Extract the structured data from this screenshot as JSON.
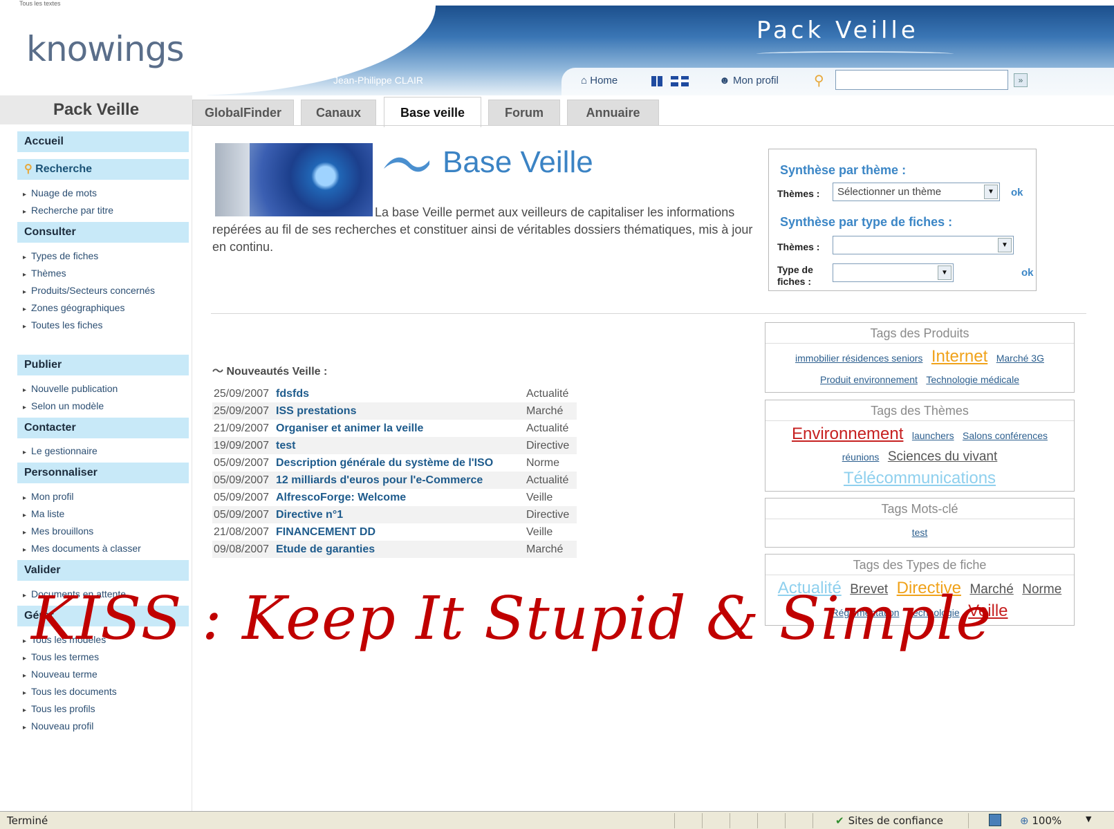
{
  "header": {
    "top_crumb": "Tous les textes",
    "logo_text": "knowings",
    "brand_title": "Pack Veille",
    "user_name": "Jean-Philippe CLAIR",
    "home_label": "Home",
    "profile_label": "Mon profil",
    "search_value": ""
  },
  "left": {
    "title": "Pack Veille",
    "accueil": "Accueil",
    "recherche": "Recherche",
    "recherche_items": [
      "Nuage de mots",
      "Recherche par titre"
    ],
    "consulter": "Consulter",
    "consulter_items": [
      "Types de fiches",
      "Thèmes",
      "Produits/Secteurs concernés",
      "Zones géographiques",
      "Toutes les fiches"
    ],
    "publier": "Publier",
    "publier_items": [
      "Nouvelle publication",
      "Selon un modèle"
    ],
    "contacter": "Contacter",
    "contacter_items": [
      "Le gestionnaire"
    ],
    "personnaliser": "Personnaliser",
    "personnaliser_items": [
      "Mon profil",
      "Ma liste",
      "Mes brouillons",
      "Mes documents à classer"
    ],
    "valider": "Valider",
    "valider_items": [
      "Documents en attente"
    ],
    "gerer": "Gérer",
    "gerer_items": [
      "Tous les modèles",
      "Tous les termes",
      "Nouveau terme",
      "Tous les documents",
      "Tous les profils",
      "Nouveau profil"
    ]
  },
  "tabs": [
    "GlobalFinder",
    "Canaux",
    "Base veille",
    "Forum",
    "Annuaire"
  ],
  "intro": {
    "title": "Base Veille",
    "text": "La base Veille permet aux veilleurs de capitaliser les informations repérées au fil de ses recherches et constituer ainsi de véritables dossiers thématiques, mis à jour en continu."
  },
  "synthese": {
    "theme_head": "Synthèse par thème :",
    "themes_label": "Thèmes :",
    "theme_select": "Sélectionner un thème",
    "ok": "ok",
    "type_head": "Synthèse par type de fiches :",
    "themes_label2": "Thèmes :",
    "type_label": "Type de fiches :"
  },
  "news": {
    "heading": "Nouveautés Veille :",
    "rows": [
      {
        "date": "25/09/2007",
        "title": "fdsfds",
        "type": "Actualité"
      },
      {
        "date": "25/09/2007",
        "title": "ISS prestations",
        "type": "Marché"
      },
      {
        "date": "21/09/2007",
        "title": "Organiser et animer la veille",
        "type": "Actualité"
      },
      {
        "date": "19/09/2007",
        "title": "test",
        "type": "Directive"
      },
      {
        "date": "05/09/2007",
        "title": "Description générale du système de l'ISO",
        "type": "Norme"
      },
      {
        "date": "05/09/2007",
        "title": "12 milliards d'euros pour l'e-Commerce",
        "type": "Actualité"
      },
      {
        "date": "05/09/2007",
        "title": "AlfrescoForge: Welcome",
        "type": "Veille"
      },
      {
        "date": "05/09/2007",
        "title": "Directive n°1",
        "type": "Directive"
      },
      {
        "date": "21/08/2007",
        "title": "FINANCEMENT DD",
        "type": "Veille"
      },
      {
        "date": "09/08/2007",
        "title": "Etude de garanties",
        "type": "Marché"
      }
    ]
  },
  "tags": {
    "produits_head": "Tags des Produits",
    "produits": [
      {
        "label": "immobilier résidences seniors",
        "size": "small",
        "color": "#2b5e8e"
      },
      {
        "label": "Internet",
        "size": "large",
        "color": "#f0a21a"
      },
      {
        "label": "Marché 3G",
        "size": "small",
        "color": "#2b5e8e"
      },
      {
        "label": "Produit environnement",
        "size": "small",
        "color": "#2b5e8e"
      },
      {
        "label": "Technologie médicale",
        "size": "small",
        "color": "#2b5e8e"
      }
    ],
    "themes_head": "Tags des Thèmes",
    "themes": [
      {
        "label": "Environnement",
        "size": "large",
        "color": "#c62020"
      },
      {
        "label": "launchers",
        "size": "small",
        "color": "#2b5e8e"
      },
      {
        "label": "Salons conférences",
        "size": "small",
        "color": "#2b5e8e"
      },
      {
        "label": "réunions",
        "size": "small",
        "color": "#2b5e8e"
      },
      {
        "label": "Sciences du vivant",
        "size": "medium",
        "color": "#555555"
      },
      {
        "label": "Télécommunications",
        "size": "large",
        "color": "#8fd0ee"
      }
    ],
    "motscle_head": "Tags Mots-clé",
    "motscle": [
      {
        "label": "test",
        "size": "small",
        "color": "#2b5e8e"
      }
    ],
    "types_head": "Tags des Types de fiche",
    "types": [
      {
        "label": "Actualité",
        "size": "large",
        "color": "#8fd0ee"
      },
      {
        "label": "Brevet",
        "size": "medium",
        "color": "#555555"
      },
      {
        "label": "Directive",
        "size": "large",
        "color": "#f0a21a"
      },
      {
        "label": "Marché",
        "size": "medium",
        "color": "#555555"
      },
      {
        "label": "Norme",
        "size": "medium",
        "color": "#555555"
      },
      {
        "label": "Réglementation",
        "size": "small",
        "color": "#2b5e8e"
      },
      {
        "label": "Technologie",
        "size": "small",
        "color": "#2b5e8e"
      },
      {
        "label": "Veille",
        "size": "large",
        "color": "#c62020"
      }
    ]
  },
  "watermark": "KISS : Keep It Stupid & Simple",
  "status": {
    "text": "Terminé",
    "zone": "Sites de confiance",
    "zoom": "100%"
  },
  "colors": {
    "accent_blue": "#3b86c6",
    "nav_head_bg": "#c8e9f8",
    "watermark_red": "#c00000"
  }
}
